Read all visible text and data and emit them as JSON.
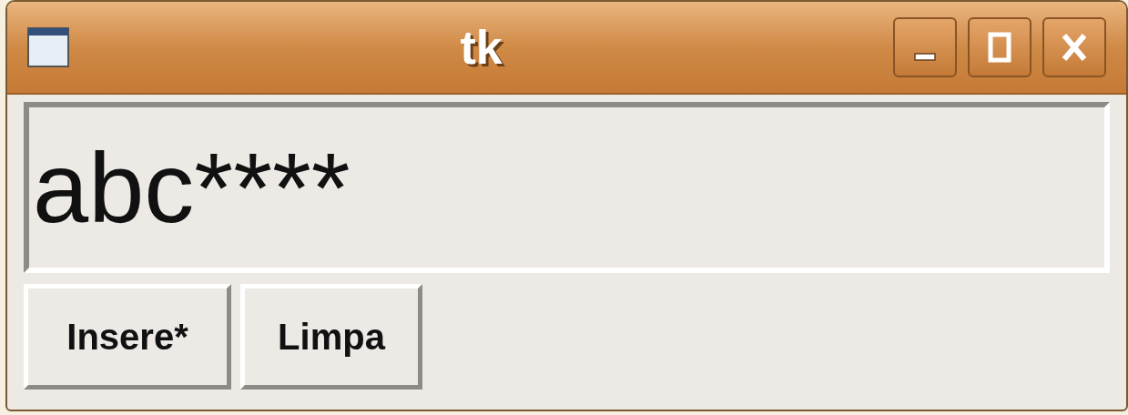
{
  "window": {
    "title": "tk"
  },
  "display": {
    "text": "abc****"
  },
  "buttons": [
    "Insere*",
    "Limpa"
  ]
}
